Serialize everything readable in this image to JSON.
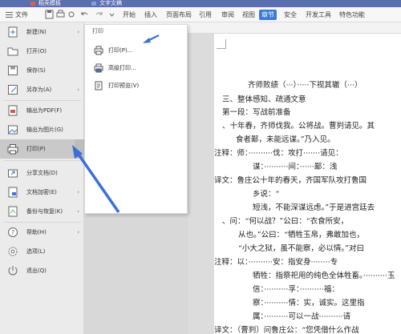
{
  "titlebar": {
    "tabs": [
      "稻壳模板",
      "文字文稿"
    ]
  },
  "toolbar": {
    "file_label": "文件"
  },
  "menu_tabs": [
    {
      "label": "开始",
      "active": false
    },
    {
      "label": "插入",
      "active": false
    },
    {
      "label": "页面布局",
      "active": false
    },
    {
      "label": "引用",
      "active": false
    },
    {
      "label": "审阅",
      "active": false
    },
    {
      "label": "视图",
      "active": false
    },
    {
      "label": "章节",
      "active": true
    },
    {
      "label": "安全",
      "active": false
    },
    {
      "label": "开发工具",
      "active": false
    },
    {
      "label": "特色功能",
      "active": false
    }
  ],
  "file_menu": {
    "items": [
      {
        "label": "新建(N)",
        "icon": "new-doc-icon",
        "arrow": true
      },
      {
        "label": "打开(O)",
        "icon": "open-folder-icon",
        "arrow": false
      },
      {
        "label": "保存(S)",
        "icon": "save-icon",
        "arrow": false
      },
      {
        "label": "另存为(A)",
        "icon": "save-as-icon",
        "arrow": true
      },
      {
        "label": "输出为PDF(F)",
        "icon": "pdf-icon",
        "arrow": false
      },
      {
        "label": "输出为图片(G)",
        "icon": "image-icon",
        "arrow": false
      },
      {
        "label": "打印(P)",
        "icon": "printer-icon",
        "arrow": true,
        "selected": true
      },
      {
        "label": "分享文档(D)",
        "icon": "share-icon",
        "arrow": false
      },
      {
        "label": "文档加密(E)",
        "icon": "encrypt-icon",
        "arrow": true
      },
      {
        "label": "备份与恢复(K)",
        "icon": "backup-icon",
        "arrow": true
      },
      {
        "label": "帮助(H)",
        "icon": "help-icon",
        "arrow": true
      },
      {
        "label": "选项(L)",
        "icon": "options-gear-icon",
        "arrow": false
      },
      {
        "label": "退出(Q)",
        "icon": "exit-icon",
        "arrow": false
      }
    ]
  },
  "print_submenu": {
    "title": "打印",
    "items": [
      {
        "label": "打印(P)...",
        "icon": "print-icon"
      },
      {
        "label": "高级打印...",
        "icon": "advanced-print-icon"
      },
      {
        "label": "打印预览(V)",
        "icon": "print-preview-icon"
      }
    ]
  },
  "document": {
    "lines": [
      "齐师败绩（···）·····下视其辙（···）",
      "三、整体感知、疏通文意",
      "第一段：写战前准备",
      "、十年春，齐师伐我。公将战。曹刿请见。其",
      "食者鄙，未能远谋。”乃入见。",
      "注释：师：··········伐：攻打·······请见：",
      "谋：··········间：······鄙：浅",
      "译文：鲁庄公十年的春天，齐国军队攻打鲁国",
      "乡说：“",
      "短浅，不能深谋远虑。”于是进宫廷去",
      "、问：“何以战？”公曰：“衣食所安，",
      "从也。”公曰：“牺牲玉帛，弗敢加也，",
      "“小大之狱，虽不能察，必以情。”对曰",
      "注释：以：··········安：指安身········专",
      "牺牲：指祭祀用的纯色全体牲畜。··········玉",
      "信：··········孚：··········福：",
      "察：··········情：实，诚实。这里指",
      "属：··········可以一战··········请",
      "译文：（曹刿）问鲁庄公：“您凭借什么作战"
    ]
  },
  "colors": {
    "titlebar": "#5b6fb0",
    "active_tab": "#3d7bd9",
    "annotation_arrow": "#3a6fd8"
  }
}
